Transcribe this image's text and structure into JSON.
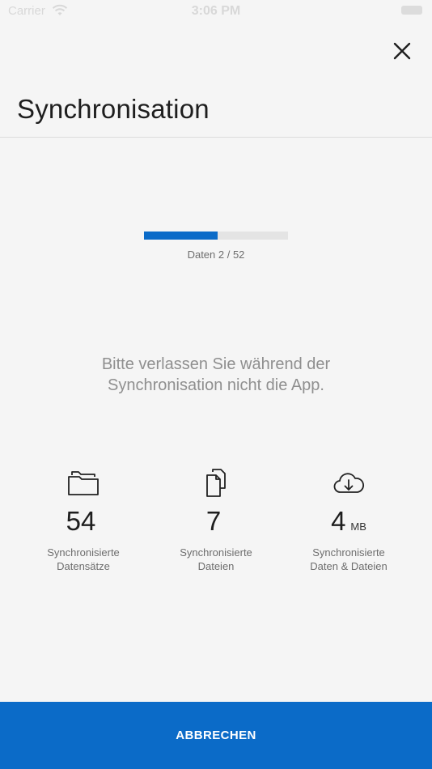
{
  "status_bar": {
    "carrier": "Carrier",
    "time": "3:06 PM",
    "wifi_icon": "wifi-icon",
    "battery_icon": "battery-icon"
  },
  "header": {
    "close_icon": "close-icon",
    "title": "Synchronisation"
  },
  "progress": {
    "fraction": 0.51,
    "label": "Daten 2 / 52",
    "fill_color": "#0b6bc8"
  },
  "message": {
    "line1": "Bitte verlassen Sie während der",
    "line2": "Synchronisation nicht die App."
  },
  "stats": [
    {
      "icon": "folders-icon",
      "value": "54",
      "unit": "",
      "label_line1": "Synchronisierte",
      "label_line2": "Datensätze"
    },
    {
      "icon": "files-icon",
      "value": "7",
      "unit": "",
      "label_line1": "Synchronisierte",
      "label_line2": "Dateien"
    },
    {
      "icon": "cloud-download-icon",
      "value": "4",
      "unit": "MB",
      "label_line1": "Synchronisierte",
      "label_line2": "Daten & Dateien"
    }
  ],
  "footer": {
    "cancel_label": "ABBRECHEN",
    "accent_color": "#0b6bc8"
  }
}
